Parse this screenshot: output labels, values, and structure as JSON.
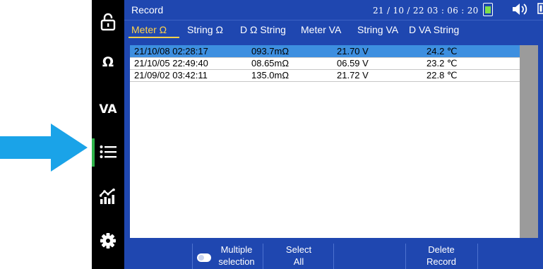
{
  "window": {
    "title": "Record",
    "datetime": "21 / 10 / 22  03 : 06 : 20"
  },
  "sidebar": {
    "items": [
      {
        "name": "lock",
        "icon": "lock-icon"
      },
      {
        "name": "ohm",
        "label": "Ω"
      },
      {
        "name": "va",
        "label": "VA"
      },
      {
        "name": "records",
        "icon": "list-icon",
        "active": true
      },
      {
        "name": "trend",
        "icon": "chart-icon"
      },
      {
        "name": "settings",
        "icon": "gear-icon"
      }
    ]
  },
  "tabs": [
    {
      "label": "Meter Ω",
      "active": true
    },
    {
      "label": "String Ω"
    },
    {
      "label": "D Ω String"
    },
    {
      "label": "Meter VA"
    },
    {
      "label": "String VA"
    },
    {
      "label": "D VA String"
    }
  ],
  "records": [
    {
      "datetime": "21/10/08 02:28:17",
      "resistance": "093.7mΩ",
      "voltage": "21.70 V",
      "temperature": "24.2 ℃",
      "selected": true
    },
    {
      "datetime": "21/10/05 22:49:40",
      "resistance": "08.65mΩ",
      "voltage": "06.59 V",
      "temperature": "23.2 ℃"
    },
    {
      "datetime": "21/09/02 03:42:11",
      "resistance": "135.0mΩ",
      "voltage": "21.72 V",
      "temperature": "22.8 ℃"
    }
  ],
  "toolbar": {
    "multiple_line1": "Multiple",
    "multiple_line2": "selection",
    "select_line1": "Select",
    "select_line2": "All",
    "delete_line1": "Delete",
    "delete_line2": "Record"
  },
  "colors": {
    "accent": "#1f47b0",
    "selected_row": "#3d8fe0",
    "active_tab": "#ffd24a",
    "arrow": "#1aa3e8",
    "active_indicator": "#2fb34a"
  }
}
